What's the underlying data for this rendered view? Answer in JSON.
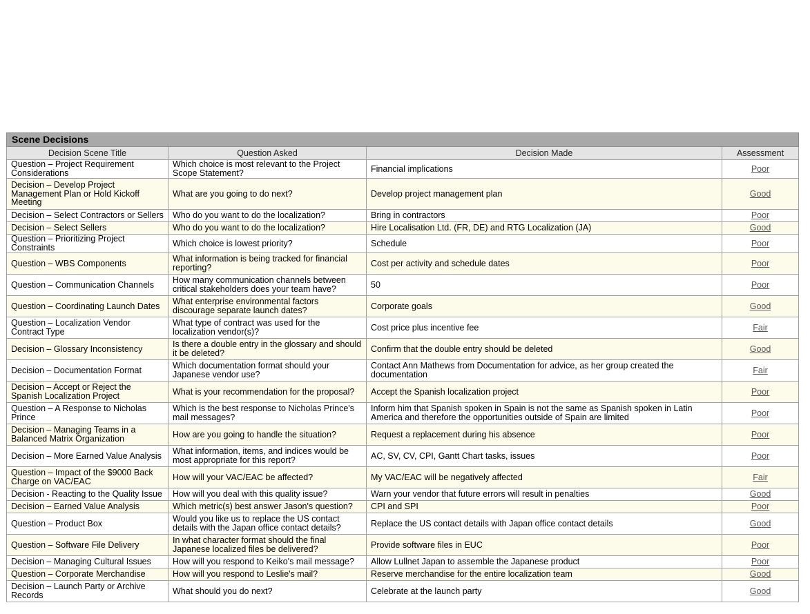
{
  "table": {
    "title": "Scene Decisions",
    "headers": [
      "Decision Scene Title",
      "Question Asked",
      "Decision Made",
      "Assessment"
    ],
    "rows": [
      {
        "scene": "Question – Project Requirement Considerations",
        "question": "Which choice is most relevant to the Project Scope Statement?",
        "decision": "Financial implications",
        "assessment": "Poor"
      },
      {
        "scene": "Decision – Develop Project Management Plan or Hold Kickoff Meeting",
        "question": "What are you going to do next?",
        "decision": "Develop project management plan",
        "assessment": "Good"
      },
      {
        "scene": "Decision – Select Contractors or Sellers",
        "question": "Who do you want to do the localization?",
        "decision": "Bring in contractors",
        "assessment": "Poor"
      },
      {
        "scene": "Decision – Select Sellers",
        "question": "Who do you want to do the localization?",
        "decision": "Hire Localisation Ltd. (FR, DE) and RTG Localization (JA)",
        "assessment": "Good"
      },
      {
        "scene": "Question – Prioritizing Project Constraints",
        "question": "Which choice is lowest priority?",
        "decision": "Schedule",
        "assessment": "Poor"
      },
      {
        "scene": "Question – WBS Components",
        "question": "What information is being tracked for financial reporting?",
        "decision": "Cost per activity and schedule dates",
        "assessment": "Poor"
      },
      {
        "scene": "Question – Communication Channels",
        "question": "How many communication channels between critical stakeholders does your team have?",
        "decision": "50",
        "assessment": "Poor"
      },
      {
        "scene": "Question – Coordinating Launch Dates",
        "question": "What enterprise environmental factors discourage separate launch dates?",
        "decision": "Corporate goals",
        "assessment": "Good"
      },
      {
        "scene": "Question – Localization Vendor Contract Type",
        "question": "What type of contract was used for the localization vendor(s)?",
        "decision": "Cost price plus incentive fee",
        "assessment": "Fair"
      },
      {
        "scene": "Decision – Glossary Inconsistency",
        "question": "Is there a double entry in the glossary and should it be deleted?",
        "decision": "Confirm that the double entry should be deleted",
        "assessment": "Good"
      },
      {
        "scene": "Decision – Documentation Format",
        "question": "Which documentation format should your Japanese vendor use?",
        "decision": "Contact Ann Mathews from Documentation for advice, as her group created the documentation",
        "assessment": "Fair"
      },
      {
        "scene": "Decision – Accept or Reject the Spanish Localization Project",
        "question": "What is your recommendation for the proposal?",
        "decision": "Accept the Spanish localization project",
        "assessment": "Poor"
      },
      {
        "scene": "Question – A Response to Nicholas Prince",
        "question": "Which is the best response to Nicholas Prince's mail messages?",
        "decision": "Inform him that Spanish spoken in Spain is not the same as Spanish spoken in Latin America and therefore the opportunities outside of Spain are limited",
        "assessment": "Poor"
      },
      {
        "scene": "Decision – Managing Teams in a Balanced Matrix Organization",
        "question": "How are you going to handle the situation?",
        "decision": "Request a replacement during his absence",
        "assessment": "Poor"
      },
      {
        "scene": "Decision – More Earned Value Analysis",
        "question": "What information, items, and indices would be most appropriate for this report?",
        "decision": "AC, SV, CV, CPI, Gantt Chart tasks, issues",
        "assessment": "Poor"
      },
      {
        "scene": "Question – Impact of the $9000 Back Charge on VAC/EAC",
        "question": "How will your VAC/EAC be affected?",
        "decision": "My VAC/EAC will be negatively affected",
        "assessment": "Fair"
      },
      {
        "scene": "Decision - Reacting to the Quality Issue",
        "question": "How will you deal with this quality issue?",
        "decision": "Warn your vendor that future errors will result in penalties",
        "assessment": "Good"
      },
      {
        "scene": "Decision – Earned Value Analysis",
        "question": "Which metric(s) best answer Jason's question?",
        "decision": "CPI and SPI",
        "assessment": "Poor"
      },
      {
        "scene": "Question – Product Box",
        "question": "Would you like us to replace the US contact details with the Japan office contact details?",
        "decision": "Replace the US contact details with Japan office contact details",
        "assessment": "Good"
      },
      {
        "scene": "Question – Software File Delivery",
        "question": "In what character format should the final Japanese localized files be delivered?",
        "decision": "Provide software files in EUC",
        "assessment": "Poor"
      },
      {
        "scene": "Decision – Managing Cultural Issues",
        "question": "How will you respond to Keiko's mail message?",
        "decision": "Allow Lullnet Japan to assemble the Japanese product",
        "assessment": "Poor"
      },
      {
        "scene": "Question – Corporate Merchandise",
        "question": "How will you respond to Leslie's mail?",
        "decision": "Reserve merchandise for the entire localization team",
        "assessment": "Good"
      },
      {
        "scene": "Decision – Launch Party or Archive Records",
        "question": "What should you do next?",
        "decision": "Celebrate at the launch party",
        "assessment": "Good"
      }
    ]
  }
}
